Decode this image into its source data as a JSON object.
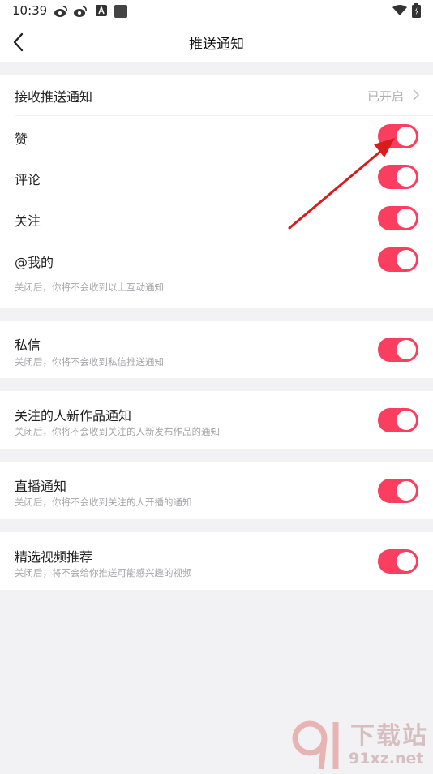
{
  "status_bar": {
    "time": "10:39"
  },
  "header": {
    "title": "推送通知"
  },
  "receive": {
    "label": "接收推送通知",
    "status": "已开启"
  },
  "interaction": {
    "items": [
      {
        "label": "赞"
      },
      {
        "label": "评论"
      },
      {
        "label": "关注"
      },
      {
        "label": "@我的"
      }
    ],
    "note": "关闭后，你将不会收到以上互动通知"
  },
  "messages": {
    "label": "私信",
    "note": "关闭后，你将不会收到私信推送通知"
  },
  "follow_works": {
    "label": "关注的人新作品通知",
    "note": "关闭后，你将不会收到关注的人新发布作品的通知"
  },
  "live": {
    "label": "直播通知",
    "note": "关闭后，你将不会收到关注的人开播的通知"
  },
  "recommend": {
    "label": "精选视频推荐",
    "note": "关闭后，将不会给你推送可能感兴趣的视频"
  },
  "watermark": {
    "brand": "下载站",
    "domain": "91xz.net"
  },
  "colors": {
    "toggle_on": "#fa3e5f",
    "background": "#f2f2f4",
    "arrow": "#d81b1b"
  }
}
